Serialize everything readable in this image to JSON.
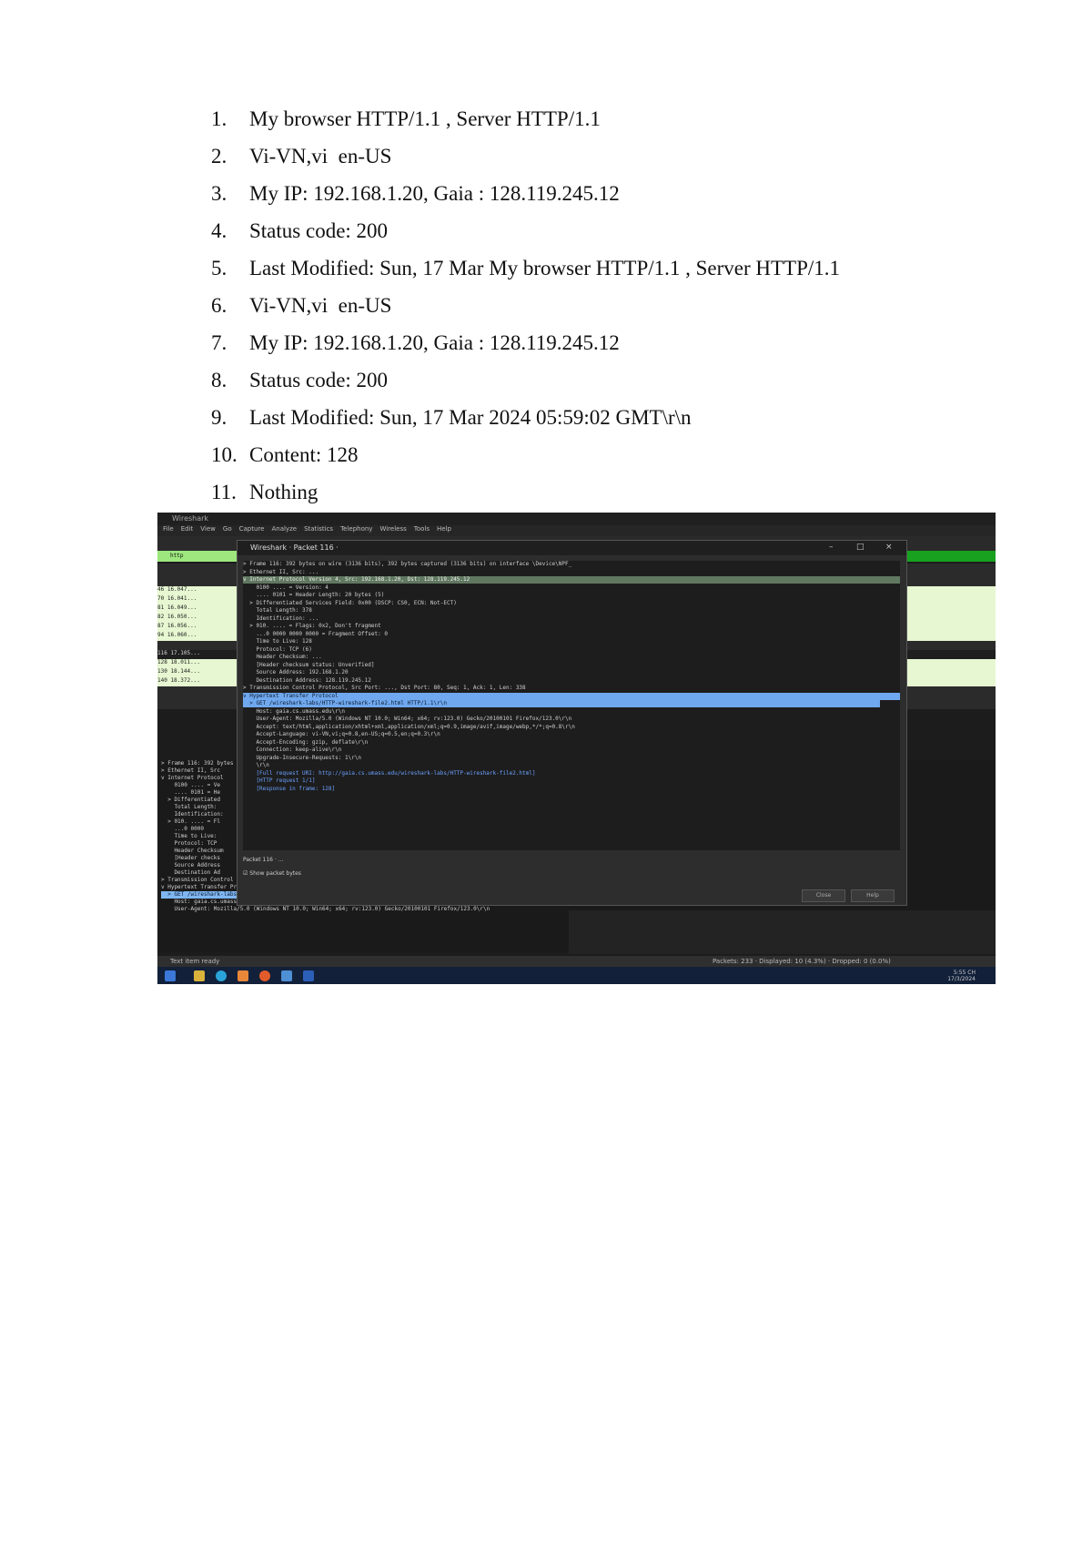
{
  "answers": [
    {
      "num": "1.",
      "text": "My browser HTTP/1.1 , Server HTTP/1.1"
    },
    {
      "num": "2.",
      "text": "Vi-VN,vi  en-US"
    },
    {
      "num": "3.",
      "text": "My IP: 192.168.1.20, Gaia : 128.119.245.12"
    },
    {
      "num": "4.",
      "text": "Status code: 200"
    },
    {
      "num": "5.",
      "text": "Last Modified: Sun, 17 Mar My browser HTTP/1.1 , Server HTTP/1.1"
    },
    {
      "num": "6.",
      "text": "Vi-VN,vi  en-US"
    },
    {
      "num": "7.",
      "text": "My IP: 192.168.1.20, Gaia : 128.119.245.12"
    },
    {
      "num": "8.",
      "text": "Status code: 200"
    },
    {
      "num": "9.",
      "text": "Last Modified: Sun, 17 Mar 2024 05:59:02 GMT\\r\\n"
    },
    {
      "num": "10.",
      "text": "Content: 128"
    },
    {
      "num": "11.",
      "text": "Nothing"
    }
  ],
  "screenshot": {
    "window_title": "Wireshark",
    "menu": [
      "File",
      "Edit",
      "View",
      "Go",
      "Capture",
      "Analyze",
      "Statistics",
      "Telephony",
      "Wireless",
      "Tools",
      "Help"
    ],
    "filter": "http",
    "dialog": {
      "title": "Wireshark · Packet 116 ·",
      "lines": [
        "> Frame 116: 392 bytes on wire (3136 bits), 392 bytes captured (3136 bits) on interface \\Device\\NPF_",
        "> Ethernet II, Src: ...",
        "v Internet Protocol Version 4, Src: 192.168.1.20, Dst: 128.119.245.12",
        "    0100 .... = Version: 4",
        "    .... 0101 = Header Length: 20 bytes (5)",
        "  > Differentiated Services Field: 0x00 (DSCP: CS0, ECN: Not-ECT)",
        "    Total Length: 378",
        "    Identification: ...",
        "  > 010. .... = Flags: 0x2, Don't fragment",
        "    ...0 0000 0000 0000 = Fragment Offset: 0",
        "    Time to Live: 128",
        "    Protocol: TCP (6)",
        "    Header Checksum: ...",
        "    [Header checksum status: Unverified]",
        "    Source Address: 192.168.1.20",
        "    Destination Address: 128.119.245.12",
        "> Transmission Control Protocol, Src Port: ..., Dst Port: 80, Seq: 1, Ack: 1, Len: 338",
        "v Hypertext Transfer Protocol",
        "  > GET /wireshark-labs/HTTP-wireshark-file2.html HTTP/1.1\\r\\n",
        "    Host: gaia.cs.umass.edu\\r\\n",
        "    User-Agent: Mozilla/5.0 (Windows NT 10.0; Win64; x64; rv:123.0) Gecko/20100101 Firefox/123.0\\r\\n",
        "    Accept: text/html,application/xhtml+xml,application/xml;q=0.9,image/avif,image/webp,*/*;q=0.8\\r\\n",
        "    Accept-Language: vi-VN,vi;q=0.8,en-US;q=0.5,en;q=0.3\\r\\n",
        "    Accept-Encoding: gzip, deflate\\r\\n",
        "    Connection: keep-alive\\r\\n",
        "    Upgrade-Insecure-Requests: 1\\r\\n",
        "    \\r\\n",
        "    [Full request URI: http://gaia.cs.umass.edu/wireshark-labs/HTTP-wireshark-file2.html]",
        "    [HTTP request 1/1]",
        "    [Response in frame: 128]"
      ],
      "footer": "Packet 116 · ...",
      "show_packet_bytes": "Show packet bytes",
      "close_label": "Close",
      "help_label": "Help"
    },
    "tree_lines": [
      "> Frame 116: 392 bytes",
      "> Ethernet II, Src",
      "v Internet Protocol",
      "    0100 .... = Ve",
      "    .... 0101 = He",
      "  > Differentiated",
      "    Total Length:",
      "    Identification:",
      "  > 010. .... = Fl",
      "    ...0 0000",
      "    Time to Live:",
      "    Protocol: TCP",
      "    Header Checksum",
      "    [Header checks",
      "    Source Address",
      "    Destination Ad",
      "> Transmission Control Protocol",
      "v Hypertext Transfer Protocol",
      "  > GET /wireshark-labs/HTTP-wireshark-file2.html HTTP/1.1\\r\\n",
      "    Host: gaia.cs.umass.edu\\r\\n",
      "    User-Agent: Mozilla/5.0 (Windows NT 10.0; Win64; x64; rv:123.0) Gecko/20100101 Firefox/123.0\\r\\n"
    ],
    "packet_rows": [
      "46 16.047...",
      "70 16.041...",
      "81 16.049...",
      "82 16.050...",
      "87 16.056...",
      "94 16.060...",
      "116 17.105...",
      "128 18.011...",
      "130 18.144...",
      "140 18.372..."
    ],
    "status_left": "Text item ready",
    "status_right": "Packets: 233 · Displayed: 10 (4.3%) · Dropped: 0 (0.0%)",
    "clock_time": "5:55 CH",
    "clock_date": "17/3/2024"
  }
}
